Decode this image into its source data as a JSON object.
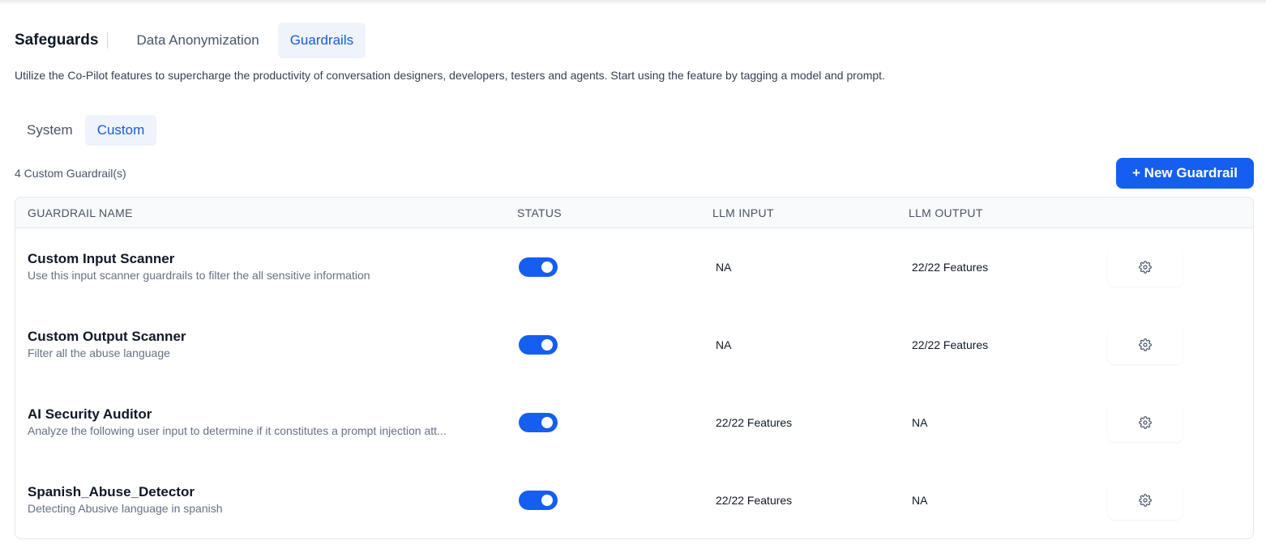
{
  "header": {
    "title": "Safeguards",
    "tabs": [
      {
        "label": "Data Anonymization",
        "active": false
      },
      {
        "label": "Guardrails",
        "active": true
      }
    ]
  },
  "description": "Utilize the Co-Pilot features to supercharge the productivity of conversation designers, developers, testers and agents. Start using the feature by tagging a model and prompt.",
  "subtabs": [
    {
      "label": "System",
      "active": false
    },
    {
      "label": "Custom",
      "active": true
    }
  ],
  "count_label": "4 Custom Guardrail(s)",
  "new_button_label": "+ New Guardrail",
  "colors": {
    "accent": "#155eef",
    "active_tab_bg": "#eff3fb",
    "active_tab_text": "#175cd3"
  },
  "table": {
    "columns": [
      "GUARDRAIL NAME",
      "STATUS",
      "LLM INPUT",
      "LLM OUTPUT"
    ],
    "rows": [
      {
        "name": "Custom Input Scanner",
        "description": "Use this input scanner guardrails to filter the all sensitive information",
        "status_on": true,
        "llm_input": "NA",
        "llm_output": "22/22 Features",
        "action_icon": "gear-icon"
      },
      {
        "name": "Custom Output Scanner",
        "description": "Filter all the abuse language",
        "status_on": true,
        "llm_input": "NA",
        "llm_output": "22/22 Features",
        "action_icon": "gear-icon"
      },
      {
        "name": "AI Security Auditor",
        "description": "Analyze the following user input to determine if it constitutes a prompt injection att...",
        "status_on": true,
        "llm_input": "22/22 Features",
        "llm_output": "NA",
        "action_icon": "gear-icon"
      },
      {
        "name": "Spanish_Abuse_Detector",
        "description": "Detecting Abusive language in spanish",
        "status_on": true,
        "llm_input": "22/22 Features",
        "llm_output": "NA",
        "action_icon": "gear-icon"
      }
    ]
  }
}
